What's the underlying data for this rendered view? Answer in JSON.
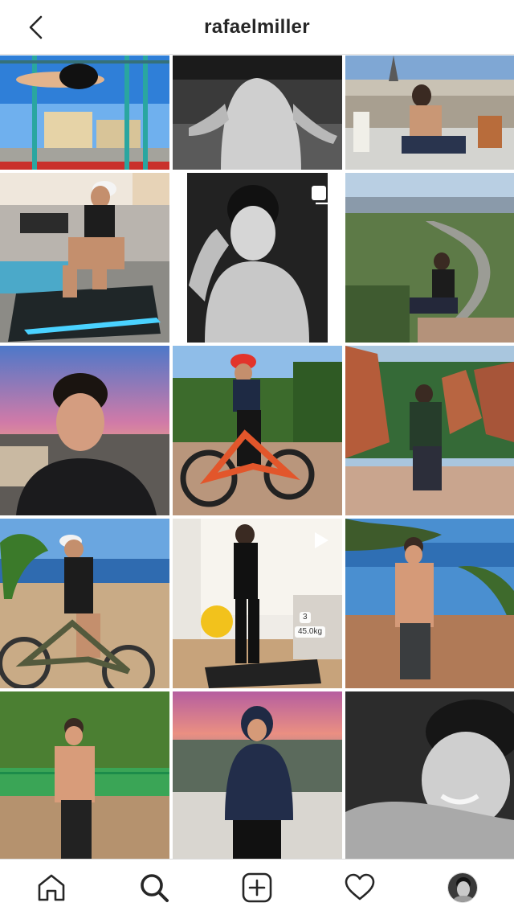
{
  "header": {
    "title": "rafaelmiller",
    "back_icon": "chevron-left-icon"
  },
  "grid": {
    "tiles": [
      {
        "kind": "photo"
      },
      {
        "kind": "photo"
      },
      {
        "kind": "photo"
      },
      {
        "kind": "photo"
      },
      {
        "kind": "carousel",
        "icon": "carousel-icon"
      },
      {
        "kind": "photo"
      },
      {
        "kind": "photo"
      },
      {
        "kind": "photo"
      },
      {
        "kind": "photo"
      },
      {
        "kind": "photo"
      },
      {
        "kind": "video",
        "icon": "play-icon",
        "overlay_texts": [
          "3",
          "45.0kg"
        ]
      },
      {
        "kind": "photo"
      },
      {
        "kind": "photo"
      },
      {
        "kind": "photo"
      },
      {
        "kind": "photo"
      }
    ]
  },
  "bottom_nav": {
    "items": [
      {
        "icon": "home-icon"
      },
      {
        "icon": "search-icon",
        "active": true
      },
      {
        "icon": "add-post-icon"
      },
      {
        "icon": "heart-icon"
      },
      {
        "icon": "profile-avatar"
      }
    ]
  },
  "colors": {
    "text": "#262626",
    "border": "#dbdbdb",
    "background": "#ffffff"
  }
}
